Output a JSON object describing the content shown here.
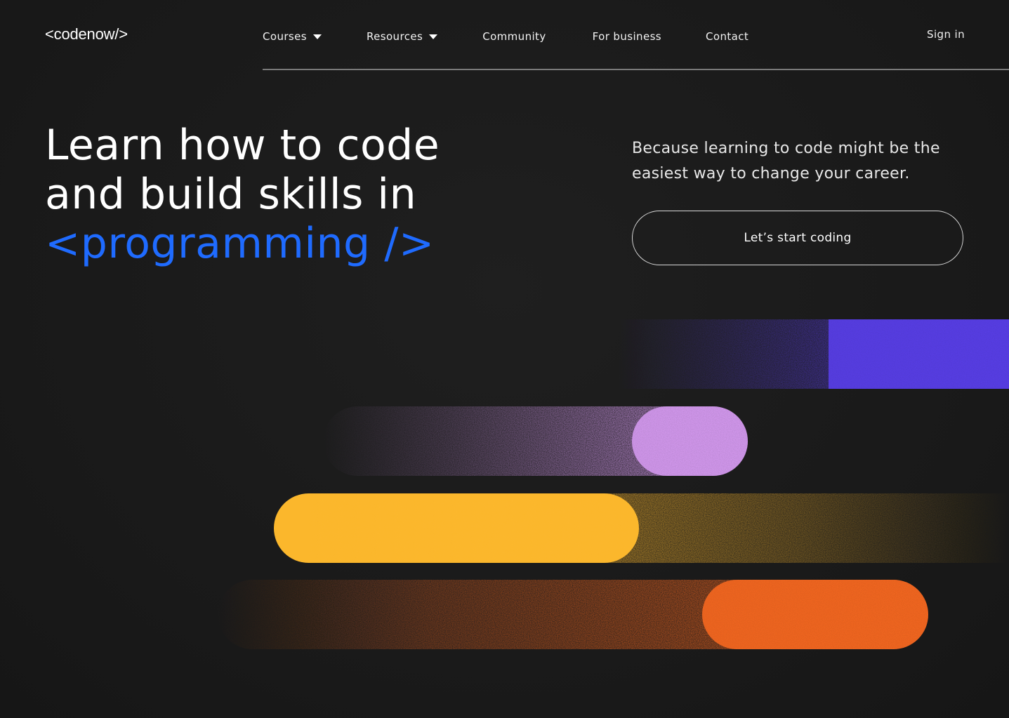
{
  "brand": {
    "logo_text": "<codenow/>"
  },
  "nav": {
    "items": [
      {
        "label": "Courses",
        "has_dropdown": true
      },
      {
        "label": "Resources",
        "has_dropdown": true
      },
      {
        "label": "Community",
        "has_dropdown": false
      },
      {
        "label": "For business",
        "has_dropdown": false
      },
      {
        "label": "Contact",
        "has_dropdown": false
      }
    ],
    "sign_in": "Sign in"
  },
  "hero": {
    "headline_line1": "Learn how to code",
    "headline_line2": "and build skills in",
    "headline_accent": "<programming />",
    "tagline": "Because learning to code might be the easiest way to change your career.",
    "cta_label": "Let’s start coding"
  },
  "colors": {
    "background": "#1b1b1b",
    "accent_blue": "#1f6bff",
    "bar_violet": "#5b3ff0",
    "bar_lilac": "#dfa0fb",
    "bar_yellow": "#fbb72c",
    "bar_orange": "#fd6a20"
  }
}
